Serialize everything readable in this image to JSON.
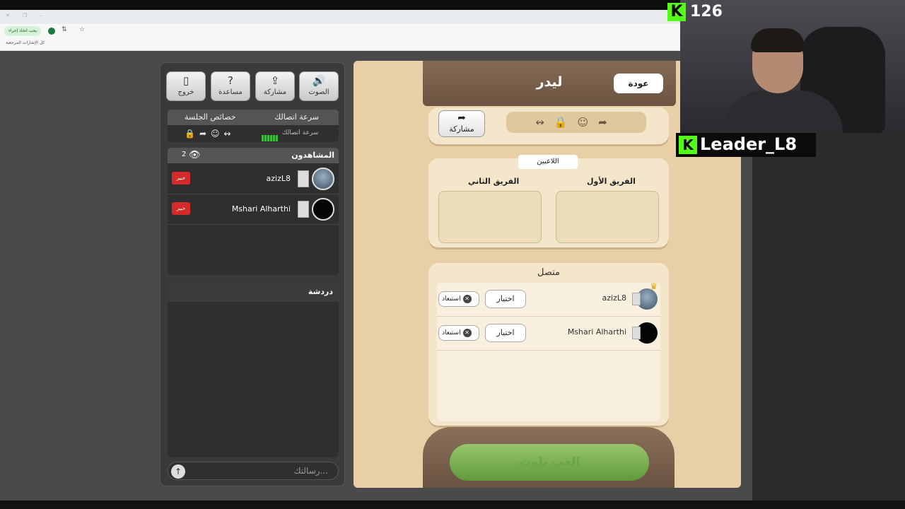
{
  "browser": {
    "pill_text": "يجب اتخاذ إجراء",
    "bookmarks_label": "كل الإشارات المرجعية"
  },
  "left_panel": {
    "buttons": [
      {
        "label": "الصوت",
        "icon": "speaker-icon"
      },
      {
        "label": "مشاركة",
        "icon": "share-icon"
      },
      {
        "label": "مساعدة",
        "icon": "help-icon"
      },
      {
        "label": "خروج",
        "icon": "exit-icon"
      }
    ],
    "info": {
      "connection_speed_header": "سرعة اتصالك",
      "session_properties_header": "خصائص الجلسة",
      "speed_label": "سرعة اتصالك"
    },
    "viewers": {
      "title": "المشاهدون",
      "count": "2",
      "list": [
        {
          "name": "azizL8",
          "badge": "خبير"
        },
        {
          "name": "Mshari Alharthi",
          "badge": "خبير"
        }
      ]
    },
    "chat": {
      "title": "دردشة",
      "placeholder": "رسالتك..."
    }
  },
  "right_panel": {
    "title": "ليدر",
    "back_label": "عودة",
    "share_label": "مشاركة",
    "players_tag": "اللاعبين",
    "team1_label": "الفريق الأول",
    "team2_label": "الفريق الثاني",
    "online_title": "متصل",
    "online_players": [
      {
        "name": "azizL8",
        "choose": "اختيار",
        "kick": "استبعاد"
      },
      {
        "name": "Mshari Alharthi",
        "choose": "اختيار",
        "kick": "استبعاد"
      }
    ],
    "play_label": "العب بلوت"
  },
  "stream": {
    "follower_count": "126",
    "streamer_name": "Leader_L8",
    "platform_letter": "K"
  },
  "colors": {
    "accent_green": "#53fc18",
    "panel_beige": "#e8cfa6",
    "header_brown": "#6b5441",
    "badge_red": "#d42a2a"
  }
}
